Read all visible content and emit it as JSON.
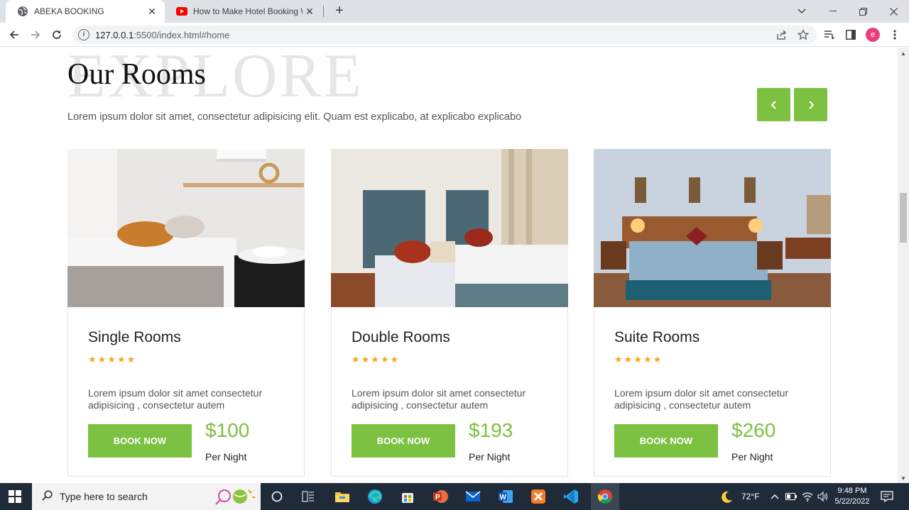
{
  "browser": {
    "tabs": [
      {
        "title": "ABEKA BOOKING",
        "active": true
      },
      {
        "title": "How to Make Hotel Booking Web",
        "active": false
      }
    ],
    "url_host": "127.0.0.1",
    "url_rest": ":5500/index.html#home",
    "profile_initial": "e"
  },
  "page": {
    "background_word": "EXPLORE",
    "heading": "Our Rooms",
    "subtext": "Lorem ipsum dolor sit amet, consectetur adipisicing elit. Quam est explicabo, at explicabo explicabo",
    "prev_arrow": "‹",
    "next_arrow": "›",
    "rooms": [
      {
        "name": "Single Rooms",
        "stars": "★★★★★",
        "rating": 5,
        "description": "Lorem ipsum dolor sit amet consectetur adipisicing , consectetur autem",
        "button": "BOOK NOW",
        "price": "$100",
        "per": "Per Night"
      },
      {
        "name": "Double Rooms",
        "stars": "★★★★★",
        "rating": 5,
        "description": "Lorem ipsum dolor sit amet consectetur adipisicing , consectetur autem",
        "button": "BOOK NOW",
        "price": "$193",
        "per": "Per Night"
      },
      {
        "name": "Suite Rooms",
        "stars": "★★★★★",
        "rating": 5,
        "description": "Lorem ipsum dolor sit amet consectetur adipisicing , consectetur autem",
        "button": "BOOK NOW",
        "price": "$260",
        "per": "Per Night"
      }
    ]
  },
  "taskbar": {
    "search_placeholder": "Type here to search",
    "weather": "72°F",
    "time": "9:48 PM",
    "date": "5/22/2022"
  },
  "colors": {
    "accent_green": "#7cc142",
    "star_orange": "#f5a623",
    "taskbar": "#202b3a"
  }
}
